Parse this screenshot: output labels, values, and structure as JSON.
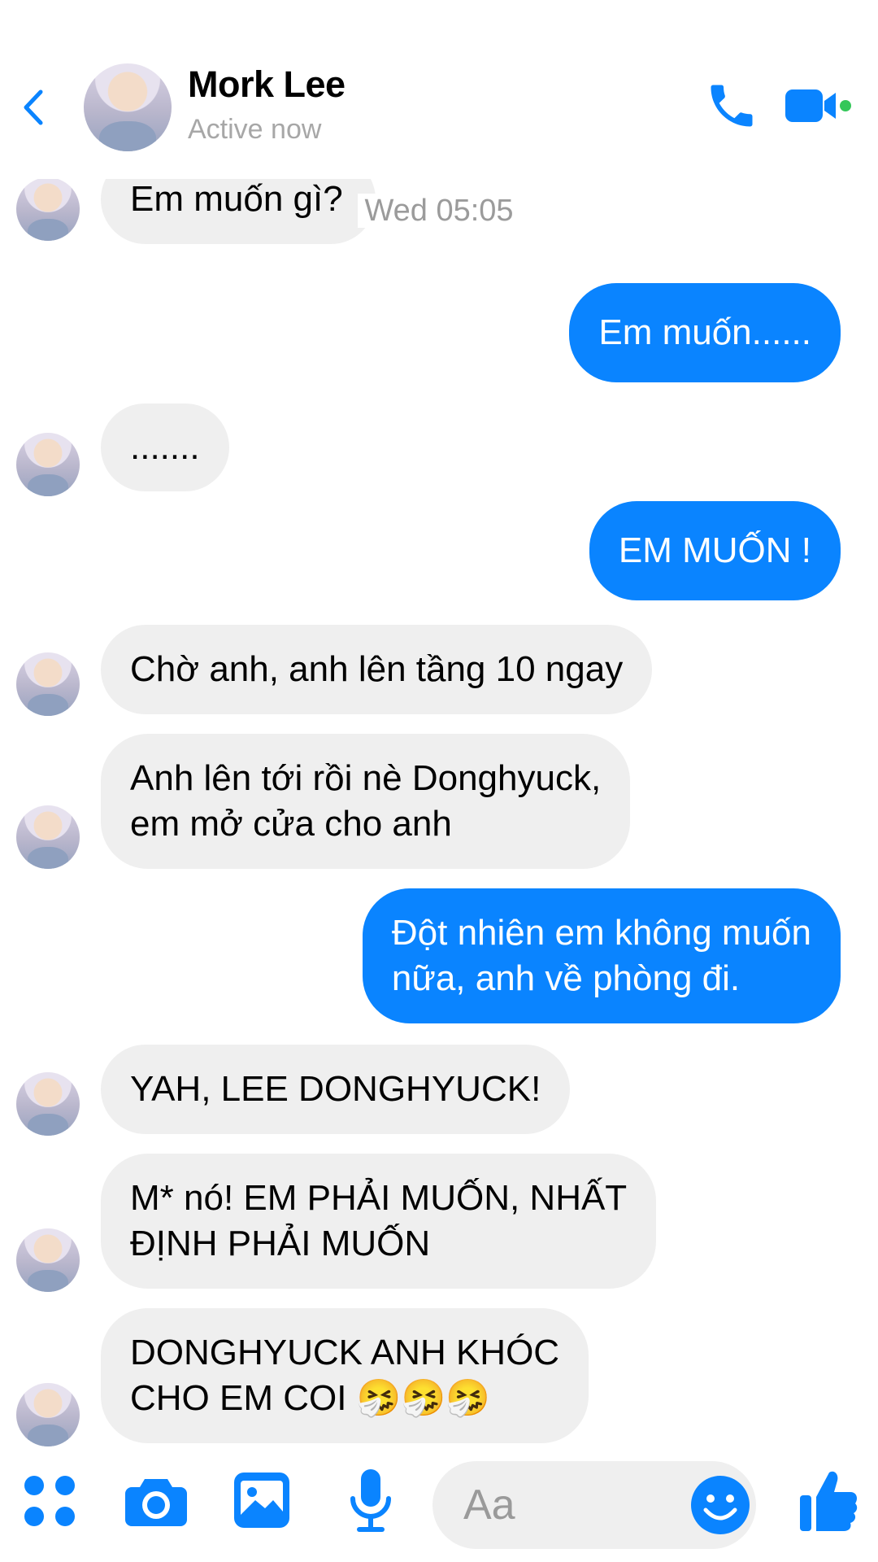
{
  "header": {
    "contact_name": "Mork Lee",
    "status": "Active now",
    "back_icon": "chevron-left-icon",
    "call_icon": "phone-icon",
    "video_icon": "video-camera-icon",
    "accent_color": "#0a84ff",
    "online_color": "#34c759"
  },
  "chat": {
    "timestamp": "Wed 05:05",
    "messages": [
      {
        "sender": "contact",
        "lines": [
          "Em muốn gì?"
        ]
      },
      {
        "sender": "me",
        "lines": [
          "Em muốn......"
        ]
      },
      {
        "sender": "contact",
        "lines": [
          "......."
        ]
      },
      {
        "sender": "me",
        "lines": [
          "EM MUỐN !"
        ]
      },
      {
        "sender": "contact",
        "lines": [
          "Chờ anh, anh lên tầng 10 ngay"
        ]
      },
      {
        "sender": "contact",
        "lines": [
          "Anh lên tới rồi nè Donghyuck,",
          "em mở cửa cho anh"
        ]
      },
      {
        "sender": "me",
        "lines": [
          "Đột nhiên em không muốn",
          "nữa, anh về phòng đi."
        ]
      },
      {
        "sender": "contact",
        "lines": [
          "YAH, LEE DONGHYUCK!"
        ]
      },
      {
        "sender": "contact",
        "lines": [
          "M* nó! EM PHẢI MUỐN, NHẤT",
          "ĐỊNH PHẢI MUỐN"
        ]
      },
      {
        "sender": "contact",
        "lines": [
          "DONGHYUCK ANH KHÓC",
          "CHO EM COI 🤧🤧🤧"
        ]
      }
    ]
  },
  "composer": {
    "placeholder": "Aa",
    "icons": [
      "apps-grid-icon",
      "camera-icon",
      "gallery-icon",
      "microphone-icon",
      "emoji-icon",
      "thumbs-up-icon"
    ]
  },
  "colors": {
    "outgoing_bubble": "#0a84ff",
    "incoming_bubble": "#efefef"
  }
}
